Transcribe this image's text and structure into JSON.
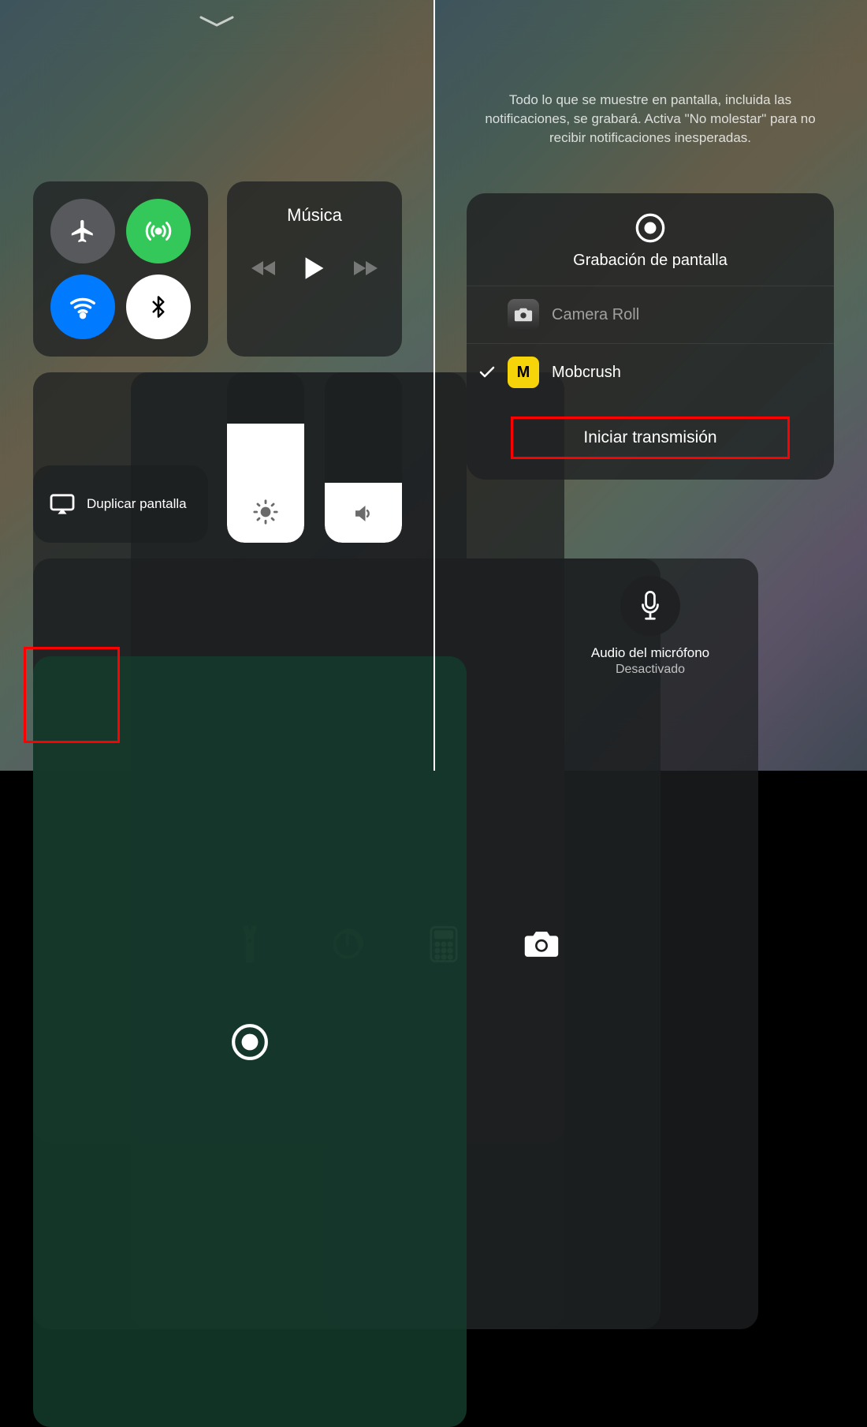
{
  "left": {
    "music_title": "Música",
    "mirror_label": "Duplicar pantalla"
  },
  "right": {
    "info": "Todo lo que se muestre en pantalla, incluida las notificaciones, se grabará. Activa \"No molestar\" para no recibir notificaciones inesperadas.",
    "panel_title": "Grabación de pantalla",
    "options": {
      "camera_roll": "Camera Roll",
      "mobcrush": "Mobcrush",
      "mobcrush_glyph": "M"
    },
    "action_label": "Iniciar transmisión",
    "mic_title": "Audio del micrófono",
    "mic_status": "Desactivado"
  }
}
